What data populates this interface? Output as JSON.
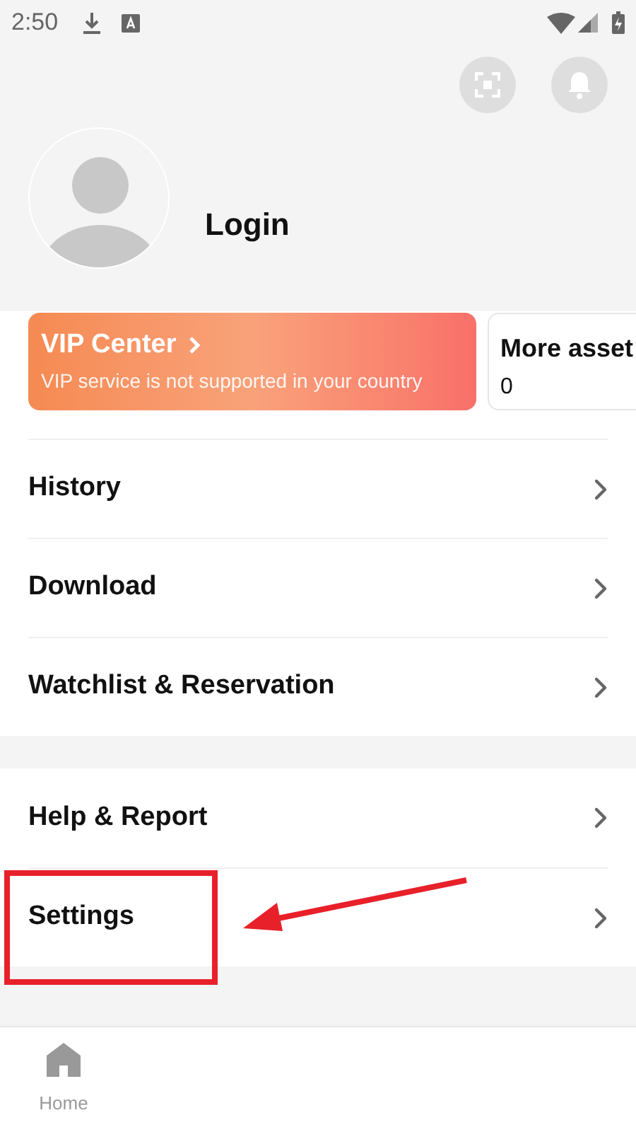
{
  "status_bar": {
    "time": "2:50"
  },
  "profile": {
    "login_label": "Login"
  },
  "vip_card": {
    "title": "VIP Center",
    "subtitle": "VIP service is not supported in your country"
  },
  "assets_card": {
    "title": "More asset",
    "count": "0"
  },
  "menu_groups": [
    {
      "items": [
        {
          "label": "History"
        },
        {
          "label": "Download"
        },
        {
          "label": "Watchlist & Reservation"
        }
      ]
    },
    {
      "items": [
        {
          "label": "Help & Report"
        },
        {
          "label": "Settings"
        }
      ]
    }
  ],
  "bottom_nav": [
    {
      "label": "Home",
      "selected": false
    }
  ]
}
